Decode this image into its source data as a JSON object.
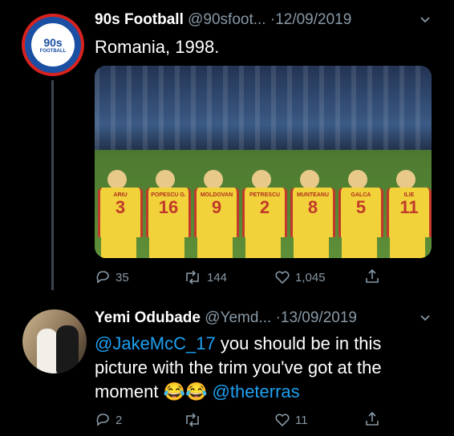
{
  "tweet1": {
    "display_name": "90s Football",
    "handle": "@90sfoot...",
    "date": "·12/09/2019",
    "text": "Romania, 1998.",
    "avatar_text": "90s",
    "avatar_subtext": "FOOTBALL",
    "photo": {
      "players": [
        {
          "name": "ARIU",
          "number": "3"
        },
        {
          "name": "POPESCU G.",
          "number": "16"
        },
        {
          "name": "MOLDOVAN",
          "number": "9"
        },
        {
          "name": "PETRESCU",
          "number": "2"
        },
        {
          "name": "MUNTEANU",
          "number": "8"
        },
        {
          "name": "GALCA",
          "number": "5"
        },
        {
          "name": "ILIE",
          "number": "11"
        }
      ]
    },
    "actions": {
      "replies": "35",
      "retweets": "144",
      "likes": "1,045"
    }
  },
  "tweet2": {
    "display_name": "Yemi Odubade",
    "handle": "@Yemd...",
    "date": "·13/09/2019",
    "mention": "@JakeMcC_17",
    "text_part": " you should be in this picture with the trim you've got at the moment ",
    "emoji": "😂😂",
    "mention2": "@theterras",
    "actions": {
      "replies": "2",
      "retweets": "",
      "likes": "11"
    }
  },
  "colors": {
    "accent": "#1da1f2",
    "muted": "#8899a6",
    "background": "#000000"
  }
}
